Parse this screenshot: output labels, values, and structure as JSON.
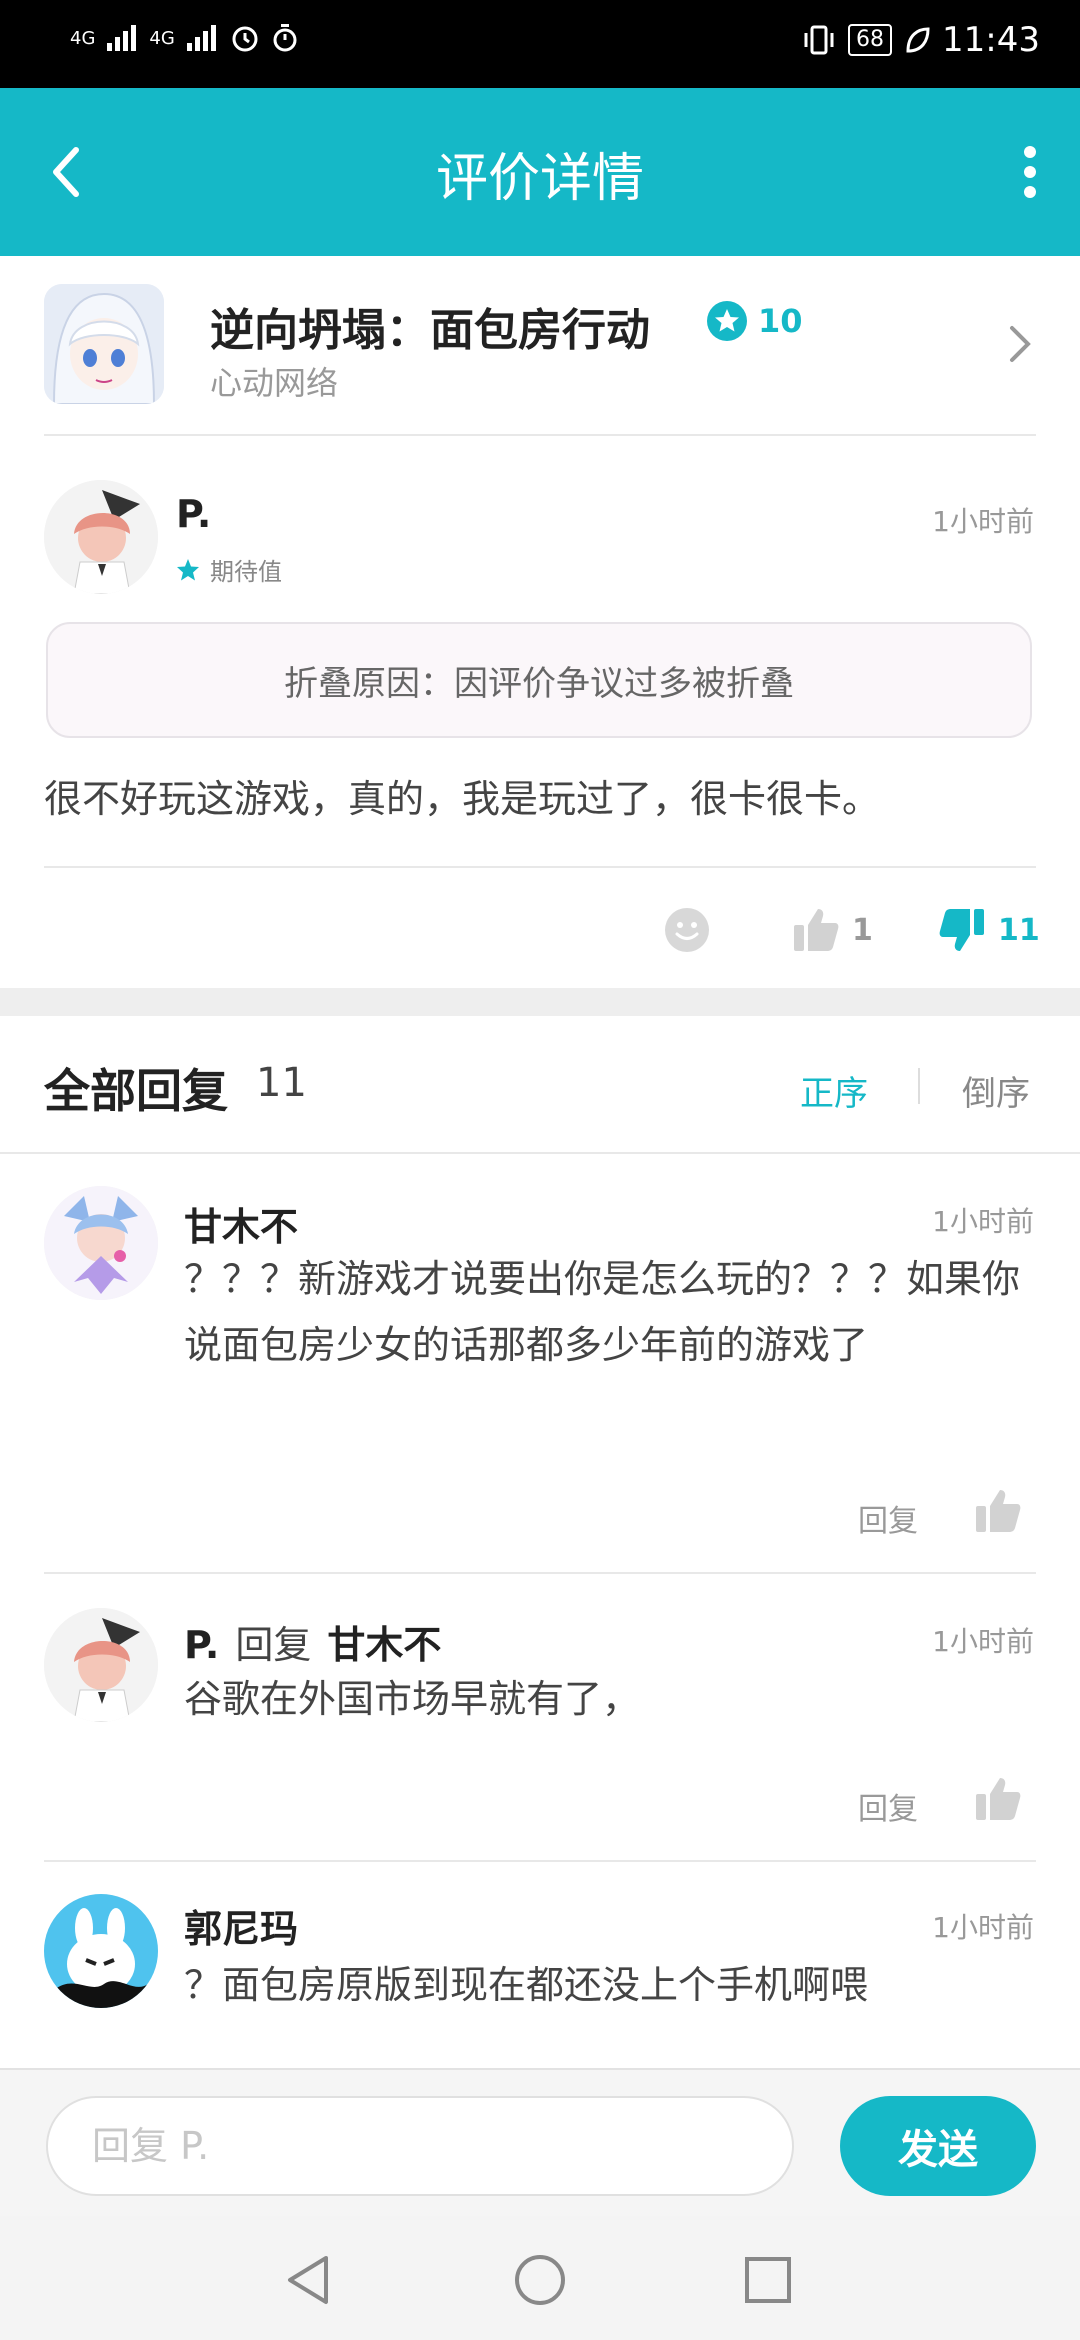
{
  "status": {
    "signal1": "4G",
    "signal2": "4G",
    "battery": "68",
    "time": "11:43"
  },
  "header": {
    "title": "评价详情"
  },
  "game": {
    "name": "逆向坍塌：面包房行动",
    "developer": "心动网络",
    "rating": "10"
  },
  "review": {
    "author": "P.",
    "time": "1小时前",
    "badge": "期待值",
    "fold_reason": "折叠原因：因评价争议过多被折叠",
    "text": "很不好玩这游戏，真的，我是玩过了，很卡很卡。",
    "likes": "1",
    "dislikes": "11"
  },
  "replies_section": {
    "title": "全部回复",
    "count": "11",
    "sort_asc": "正序",
    "sort_desc": "倒序"
  },
  "replies": [
    {
      "author": "甘木不",
      "time": "1小时前",
      "text": "？？？新游戏才说要出你是怎么玩的？？？如果你说面包房少女的话那都多少年前的游戏了",
      "reply_label": "回复"
    },
    {
      "author": "P.",
      "reply_word": "回复",
      "reply_to": "甘木不",
      "time": "1小时前",
      "text": "谷歌在外国市场早就有了，",
      "reply_label": "回复"
    },
    {
      "author": "郭尼玛",
      "time": "1小时前",
      "text": "？面包房原版到现在都还没上个手机啊喂"
    }
  ],
  "composer": {
    "placeholder": "回复 P.",
    "send_label": "发送"
  },
  "colors": {
    "accent": "#15b8c7",
    "statusbar": "#000000"
  }
}
